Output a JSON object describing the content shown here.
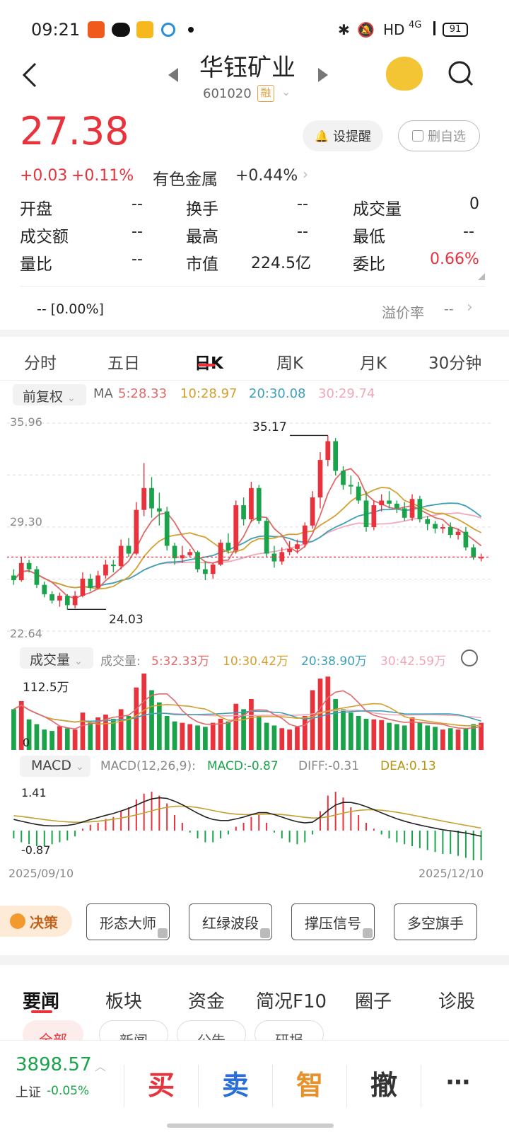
{
  "status_bar": {
    "time": "09:21",
    "network": "HD",
    "signal": "4G",
    "battery": "91"
  },
  "header": {
    "stock_name": "华钰矿业",
    "stock_code": "601020",
    "margin_badge": "融"
  },
  "quote": {
    "price": "27.38",
    "change": "+0.03",
    "change_pct": "+0.11%",
    "sector": "有色金属",
    "sector_change": "+0.44%",
    "alert_label": "设提醒",
    "remove_label": "删自选",
    "stats": [
      {
        "label": "开盘",
        "value": "--"
      },
      {
        "label": "换手",
        "value": "--"
      },
      {
        "label": "成交量",
        "value": "0"
      },
      {
        "label": "成交额",
        "value": "--"
      },
      {
        "label": "最高",
        "value": "--"
      },
      {
        "label": "最低",
        "value": "--"
      },
      {
        "label": "量比",
        "value": "--"
      },
      {
        "label": "市值",
        "value": "224.5亿"
      },
      {
        "label": "委比",
        "value": "0.66%"
      }
    ],
    "premium_left": "-- [0.00%]",
    "premium_label": "溢价率",
    "premium_value": "--"
  },
  "tabs": [
    "分时",
    "五日",
    "日K",
    "周K",
    "月K",
    "30分钟"
  ],
  "active_tab": "日K",
  "ma_bar": {
    "adjust": "前复权",
    "label": "MA",
    "ma5": "5:28.33",
    "ma10": "10:28.97",
    "ma20": "20:30.08",
    "ma30": "30:29.74"
  },
  "vol_bar": {
    "label": "成交量",
    "title": "成交量:",
    "v5": "5:32.33万",
    "v10": "10:30.42万",
    "v20": "20:38.90万",
    "v30": "30:42.59万"
  },
  "macd_bar": {
    "label": "MACD",
    "params": "MACD(12,26,9):",
    "macd": "MACD:-0.87",
    "diff": "DIFF:-0.31",
    "dea": "DEA:0.13"
  },
  "chart_labels": {
    "y_top": "35.96",
    "y_mid": "29.30",
    "y_bottom": "22.64",
    "high": "35.17",
    "low": "24.03",
    "vol_max": "112.5万",
    "vol_zero": "0",
    "macd_top": "1.41",
    "macd_bottom": "-0.87",
    "date_start": "2025/09/10",
    "date_end": "2025/12/10"
  },
  "colors": {
    "up": "#e8323c",
    "down": "#1aa34a",
    "ma5": "#e06a6a",
    "ma10": "#d4a030",
    "ma20": "#3ca0b8",
    "ma30": "#f0a8b8"
  },
  "tools": {
    "decision": "决策",
    "chips": [
      "形态大师",
      "红绿波段",
      "撑压信号",
      "多空旗手"
    ]
  },
  "news_tabs": [
    "要闻",
    "板块",
    "资金",
    "简况F10",
    "圈子",
    "诊股"
  ],
  "news_subtabs": [
    "全部",
    "新闻",
    "公告",
    "研报"
  ],
  "bottom": {
    "index_value": "3898.57",
    "index_name": "上证",
    "index_change": "-0.05%",
    "buy": "买",
    "sell": "卖",
    "smart": "智",
    "cancel": "撤",
    "more": "⋯"
  },
  "chart_data": {
    "type": "candlestick",
    "x_range": [
      "2025/09/10",
      "2025/12/10"
    ],
    "ylim": [
      22.64,
      35.96
    ],
    "candles": [
      [
        26.2,
        26.6,
        25.6,
        25.9
      ],
      [
        25.9,
        27.4,
        25.8,
        27.0
      ],
      [
        27.0,
        27.2,
        26.4,
        26.6
      ],
      [
        26.6,
        26.8,
        25.4,
        25.6
      ],
      [
        25.6,
        25.8,
        24.8,
        25.0
      ],
      [
        25.0,
        25.2,
        24.4,
        24.6
      ],
      [
        24.6,
        25.1,
        24.2,
        24.9
      ],
      [
        24.9,
        25.0,
        24.03,
        24.3
      ],
      [
        24.3,
        25.2,
        24.1,
        24.9
      ],
      [
        24.9,
        26.4,
        24.8,
        26.0
      ],
      [
        26.0,
        26.3,
        25.2,
        25.4
      ],
      [
        25.4,
        26.5,
        25.3,
        26.2
      ],
      [
        26.2,
        27.2,
        26.0,
        26.9
      ],
      [
        26.9,
        27.2,
        26.4,
        26.8
      ],
      [
        26.8,
        28.5,
        26.6,
        28.1
      ],
      [
        28.1,
        28.6,
        27.4,
        27.6
      ],
      [
        27.6,
        30.9,
        27.5,
        30.4
      ],
      [
        30.4,
        33.4,
        30.0,
        31.8
      ],
      [
        31.8,
        32.5,
        29.9,
        30.5
      ],
      [
        30.5,
        31.5,
        29.4,
        30.3
      ],
      [
        30.3,
        30.6,
        27.8,
        28.1
      ],
      [
        28.1,
        28.3,
        26.9,
        27.3
      ],
      [
        27.3,
        28.1,
        27.0,
        27.5
      ],
      [
        27.5,
        27.9,
        27.4,
        27.7
      ],
      [
        27.7,
        27.8,
        26.4,
        26.6
      ],
      [
        26.6,
        27.1,
        25.9,
        26.3
      ],
      [
        26.3,
        27.0,
        26.0,
        26.9
      ],
      [
        26.9,
        28.5,
        26.8,
        28.3
      ],
      [
        28.3,
        28.9,
        27.6,
        27.8
      ],
      [
        27.8,
        31.0,
        27.6,
        30.7
      ],
      [
        30.7,
        31.2,
        29.4,
        29.8
      ],
      [
        29.8,
        32.2,
        29.6,
        31.8
      ],
      [
        31.8,
        32.0,
        29.5,
        29.7
      ],
      [
        29.7,
        29.9,
        27.4,
        27.6
      ],
      [
        27.6,
        28.1,
        26.7,
        27.1
      ],
      [
        27.1,
        28.0,
        26.9,
        27.7
      ],
      [
        27.7,
        28.4,
        27.5,
        27.9
      ],
      [
        27.9,
        28.5,
        27.6,
        28.2
      ],
      [
        28.2,
        29.6,
        28.0,
        29.4
      ],
      [
        29.4,
        31.6,
        29.2,
        31.2
      ],
      [
        31.2,
        34.1,
        30.5,
        33.6
      ],
      [
        33.6,
        35.17,
        33.2,
        34.8
      ],
      [
        34.8,
        35.0,
        32.6,
        32.9
      ],
      [
        32.9,
        33.2,
        31.7,
        32.0
      ],
      [
        32.0,
        32.6,
        31.4,
        31.9
      ],
      [
        31.9,
        32.2,
        30.8,
        31.0
      ],
      [
        31.0,
        31.6,
        29.0,
        29.3
      ],
      [
        29.3,
        31.0,
        29.1,
        30.7
      ],
      [
        30.7,
        31.4,
        30.3,
        31.0
      ],
      [
        31.0,
        31.6,
        30.5,
        30.8
      ],
      [
        30.8,
        31.0,
        30.2,
        30.5
      ],
      [
        30.5,
        30.9,
        29.7,
        29.9
      ],
      [
        29.9,
        31.4,
        29.7,
        31.1
      ],
      [
        31.1,
        31.3,
        29.6,
        29.8
      ],
      [
        29.8,
        30.0,
        29.1,
        29.5
      ],
      [
        29.5,
        29.7,
        28.9,
        29.2
      ],
      [
        29.2,
        29.5,
        28.9,
        29.3
      ],
      [
        29.3,
        29.6,
        28.6,
        28.8
      ],
      [
        28.8,
        29.2,
        28.5,
        29.0
      ],
      [
        29.0,
        29.3,
        27.8,
        28.0
      ],
      [
        28.0,
        28.2,
        27.2,
        27.35
      ],
      [
        27.35,
        27.6,
        27.1,
        27.38
      ]
    ],
    "volume": [
      60,
      72,
      45,
      38,
      30,
      28,
      35,
      32,
      30,
      55,
      40,
      48,
      52,
      46,
      60,
      50,
      92,
      112.5,
      88,
      70,
      50,
      42,
      40,
      38,
      36,
      34,
      40,
      46,
      42,
      68,
      60,
      75,
      50,
      40,
      36,
      32,
      30,
      34,
      50,
      88,
      105,
      108,
      75,
      60,
      55,
      50,
      46,
      45,
      44,
      40,
      38,
      36,
      48,
      40,
      36,
      34,
      30,
      32,
      30,
      32,
      38,
      40
    ],
    "macd_hist": [
      -0.2,
      -0.3,
      -0.35,
      -0.4,
      -0.4,
      -0.35,
      -0.3,
      -0.25,
      -0.15,
      0.05,
      0.15,
      0.2,
      0.3,
      0.35,
      0.5,
      0.6,
      0.8,
      0.95,
      1.0,
      0.9,
      0.7,
      0.4,
      0.2,
      -0.05,
      -0.2,
      -0.3,
      -0.3,
      -0.2,
      -0.1,
      0.1,
      0.2,
      0.35,
      0.4,
      0.2,
      -0.05,
      -0.2,
      -0.3,
      -0.35,
      -0.3,
      -0.1,
      0.5,
      0.9,
      1.0,
      0.85,
      0.6,
      0.4,
      0.2,
      0.05,
      -0.1,
      -0.2,
      -0.3,
      -0.35,
      -0.4,
      -0.45,
      -0.5,
      -0.55,
      -0.6,
      -0.6,
      -0.65,
      -0.7,
      -0.8,
      -0.87
    ]
  }
}
